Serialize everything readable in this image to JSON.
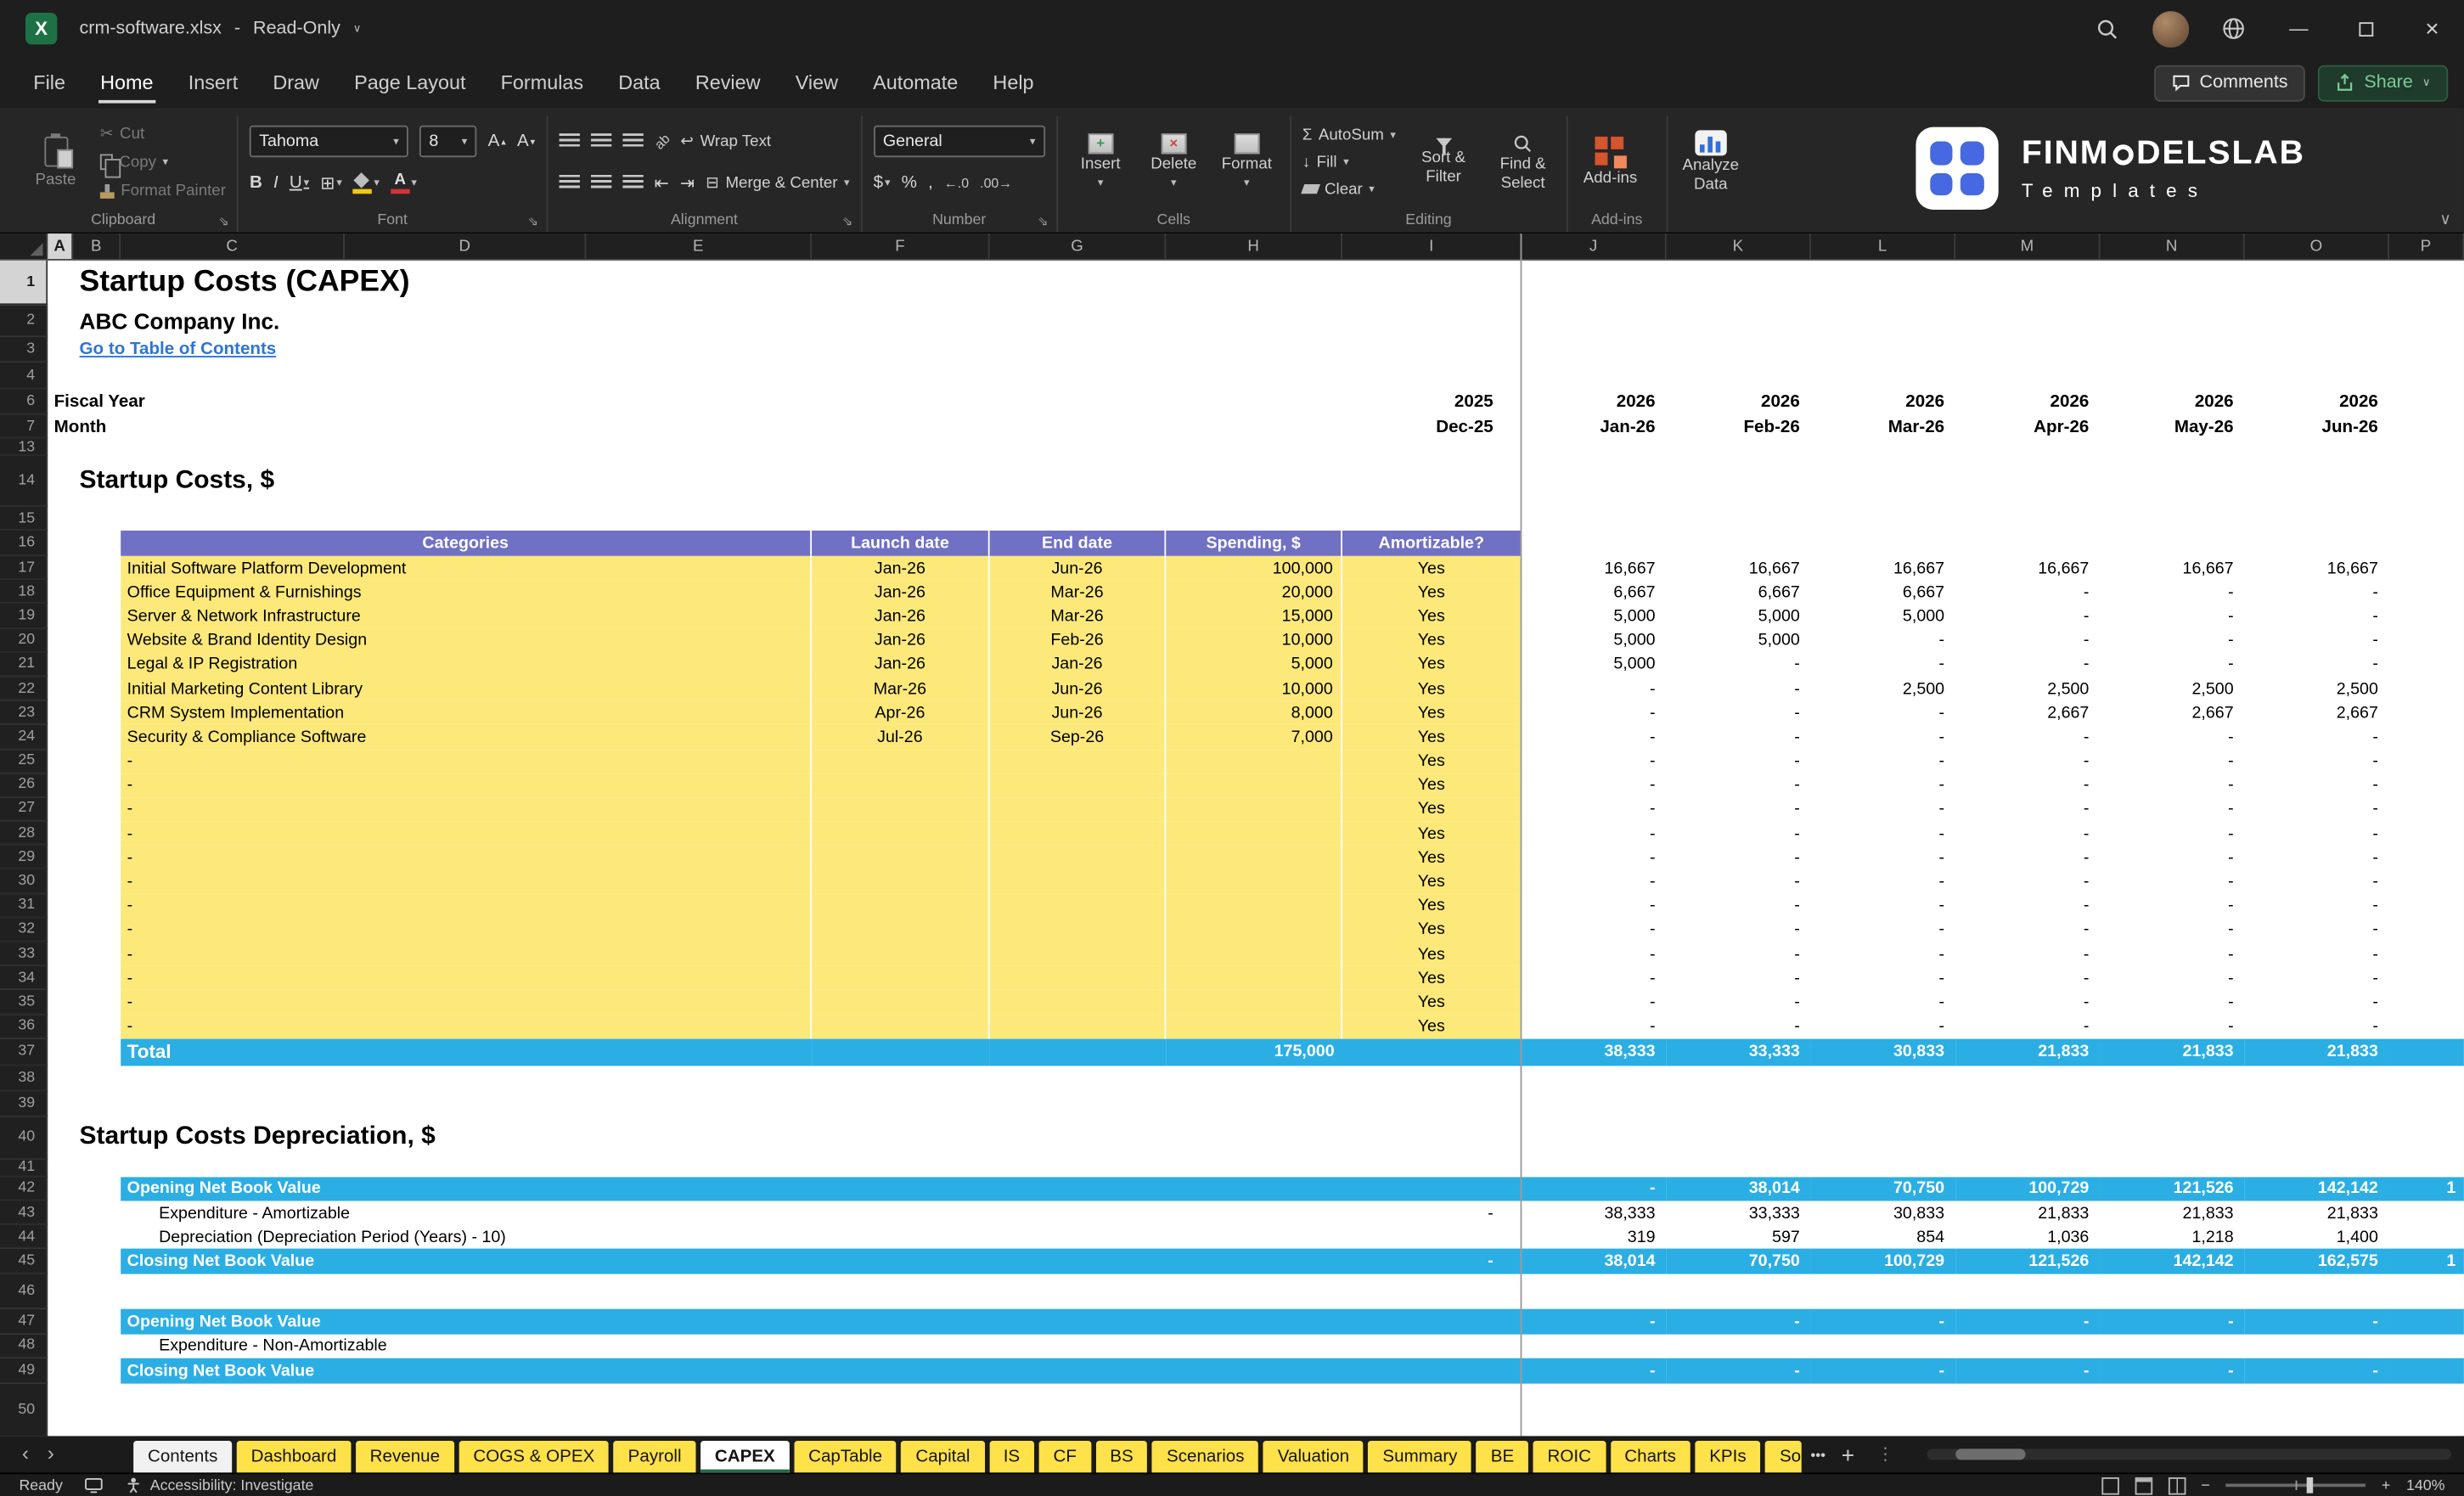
{
  "colors": {
    "band_blue": "#2BAEE4",
    "header_purple": "#7070C5",
    "cell_yellow": "#FDE97A",
    "tab_yellow": "#FFE14A",
    "link_blue": "#2E75D4",
    "excel_green": "#1E7145"
  },
  "icons": {
    "chevron_down": "▾",
    "chevron_small": "∨",
    "scissors": "✂",
    "sigma": "Σ",
    "borders": "⊞",
    "merge": "⊟",
    "wrap": "↩",
    "bold": "B",
    "italic": "I",
    "underline": "U",
    "dollar": "$",
    "percent": "%",
    "comma": ",",
    "increase_decimal": "←.0",
    "decrease_decimal": ".00→",
    "indent_left": "⇤",
    "indent_right": "⇥",
    "letter_a": "A",
    "up": "▴",
    "down": "▾",
    "minimize": "—",
    "close": "×",
    "nav_left": "‹",
    "nav_right": "›",
    "splitter": "⋮",
    "zoom_out": "−",
    "zoom_in": "+",
    "orientation": "ab",
    "excel_x": "X",
    "fill_arrow": "↓",
    "insert_plus": "+",
    "delete_x": "×"
  },
  "titlebar": {
    "filename": "crm-software.xlsx",
    "dash": "-",
    "mode": "Read-Only"
  },
  "menubar": {
    "items": [
      "File",
      "Home",
      "Insert",
      "Draw",
      "Page Layout",
      "Formulas",
      "Data",
      "Review",
      "View",
      "Automate",
      "Help"
    ],
    "active_item": "Home",
    "comments_label": "Comments",
    "share_label": "Share"
  },
  "ribbon": {
    "clipboard": {
      "label": "Clipboard",
      "paste": "Paste",
      "cut": "Cut",
      "copy": "Copy",
      "format_painter": "Format Painter"
    },
    "font": {
      "label": "Font",
      "font_name": "Tahoma",
      "font_size": "8"
    },
    "alignment": {
      "label": "Alignment",
      "wrap_text": "Wrap Text",
      "merge_center": "Merge & Center"
    },
    "number": {
      "label": "Number",
      "format": "General"
    },
    "cells": {
      "label": "Cells",
      "insert": "Insert",
      "delete": "Delete",
      "format": "Format"
    },
    "editing": {
      "label": "Editing",
      "autosum": "AutoSum",
      "fill": "Fill",
      "clear": "Clear",
      "sort_line1": "Sort &",
      "sort_line2": "Filter",
      "find_line1": "Find &",
      "find_line2": "Select"
    },
    "addins": {
      "label": "Add-ins",
      "addins_label": "Add-ins",
      "analyze_line1": "Analyze",
      "analyze_line2": "Data"
    },
    "logo": {
      "brand_pre": "FINM",
      "brand_post": "DELSLAB",
      "subtitle": "Templates"
    }
  },
  "sheet": {
    "columns": [
      "A",
      "B",
      "C",
      "D",
      "E",
      "F",
      "G",
      "H",
      "I",
      "J",
      "K",
      "L",
      "M",
      "N",
      "O",
      "P"
    ]
  },
  "grid_rows": [
    {
      "n": "1",
      "h": 28,
      "type": "title",
      "text": "Startup Costs (CAPEX)"
    },
    {
      "n": "2",
      "h": 20,
      "type": "subtitle",
      "text": "ABC Company Inc."
    },
    {
      "n": "3",
      "h": 16,
      "type": "link",
      "text": "Go to Table of Contents"
    },
    {
      "n": "4",
      "h": 17,
      "type": "blank"
    },
    {
      "n": "6",
      "h": 16,
      "type": "frozen",
      "label": "Fiscal Year",
      "dec": "2025",
      "vals": [
        "2026",
        "2026",
        "2026",
        "2026",
        "2026",
        "2026"
      ]
    },
    {
      "n": "7",
      "h": 15,
      "type": "frozen",
      "label": "Month",
      "dec": "Dec-25",
      "vals": [
        "Jan-26",
        "Feb-26",
        "Mar-26",
        "Apr-26",
        "May-26",
        "Jun-26"
      ]
    },
    {
      "n": "13",
      "h": 11,
      "type": "blank"
    },
    {
      "n": "14",
      "h": 32,
      "type": "section",
      "text": "Startup Costs, $"
    },
    {
      "n": "15",
      "h": 15,
      "type": "blank"
    },
    {
      "n": "16",
      "h": 16,
      "type": "thead",
      "cols": [
        "Categories",
        "Launch date",
        "End date",
        "Spending, $",
        "Amortizable?"
      ]
    },
    {
      "n": "17",
      "h": 15.2,
      "type": "item",
      "cat": "Initial Software Platform Development",
      "launch": "Jan-26",
      "end": "Jun-26",
      "spend": "100,000",
      "amort": "Yes",
      "vals": [
        "16,667",
        "16,667",
        "16,667",
        "16,667",
        "16,667",
        "16,667"
      ]
    },
    {
      "n": "18",
      "h": 15.2,
      "type": "item",
      "cat": "Office Equipment & Furnishings",
      "launch": "Jan-26",
      "end": "Mar-26",
      "spend": "20,000",
      "amort": "Yes",
      "vals": [
        "6,667",
        "6,667",
        "6,667",
        "-",
        "-",
        "-"
      ]
    },
    {
      "n": "19",
      "h": 15.2,
      "type": "item",
      "cat": "Server & Network Infrastructure",
      "launch": "Jan-26",
      "end": "Mar-26",
      "spend": "15,000",
      "amort": "Yes",
      "vals": [
        "5,000",
        "5,000",
        "5,000",
        "-",
        "-",
        "-"
      ]
    },
    {
      "n": "20",
      "h": 15.2,
      "type": "item",
      "cat": "Website & Brand Identity Design",
      "launch": "Jan-26",
      "end": "Feb-26",
      "spend": "10,000",
      "amort": "Yes",
      "vals": [
        "5,000",
        "5,000",
        "-",
        "-",
        "-",
        "-"
      ]
    },
    {
      "n": "21",
      "h": 15.2,
      "type": "item",
      "cat": "Legal & IP Registration",
      "launch": "Jan-26",
      "end": "Jan-26",
      "spend": "5,000",
      "amort": "Yes",
      "vals": [
        "5,000",
        "-",
        "-",
        "-",
        "-",
        "-"
      ]
    },
    {
      "n": "22",
      "h": 15.2,
      "type": "item",
      "cat": "Initial Marketing Content Library",
      "launch": "Mar-26",
      "end": "Jun-26",
      "spend": "10,000",
      "amort": "Yes",
      "vals": [
        "-",
        "-",
        "2,500",
        "2,500",
        "2,500",
        "2,500"
      ]
    },
    {
      "n": "23",
      "h": 15.2,
      "type": "item",
      "cat": "CRM System Implementation",
      "launch": "Apr-26",
      "end": "Jun-26",
      "spend": "8,000",
      "amort": "Yes",
      "vals": [
        "-",
        "-",
        "-",
        "2,667",
        "2,667",
        "2,667"
      ]
    },
    {
      "n": "24",
      "h": 15.2,
      "type": "item",
      "cat": "Security & Compliance Software",
      "launch": "Jul-26",
      "end": "Sep-26",
      "spend": "7,000",
      "amort": "Yes",
      "vals": [
        "-",
        "-",
        "-",
        "-",
        "-",
        "-"
      ]
    },
    {
      "n": "25",
      "h": 15.2,
      "type": "item",
      "cat": "-",
      "launch": "",
      "end": "",
      "spend": "",
      "amort": "Yes",
      "vals": [
        "-",
        "-",
        "-",
        "-",
        "-",
        "-"
      ]
    },
    {
      "n": "26",
      "h": 15.2,
      "type": "item",
      "cat": "-",
      "launch": "",
      "end": "",
      "spend": "",
      "amort": "Yes",
      "vals": [
        "-",
        "-",
        "-",
        "-",
        "-",
        "-"
      ]
    },
    {
      "n": "27",
      "h": 15.2,
      "type": "item",
      "cat": "-",
      "launch": "",
      "end": "",
      "spend": "",
      "amort": "Yes",
      "vals": [
        "-",
        "-",
        "-",
        "-",
        "-",
        "-"
      ]
    },
    {
      "n": "28",
      "h": 15.2,
      "type": "item",
      "cat": "-",
      "launch": "",
      "end": "",
      "spend": "",
      "amort": "Yes",
      "vals": [
        "-",
        "-",
        "-",
        "-",
        "-",
        "-"
      ]
    },
    {
      "n": "29",
      "h": 15.2,
      "type": "item",
      "cat": "-",
      "launch": "",
      "end": "",
      "spend": "",
      "amort": "Yes",
      "vals": [
        "-",
        "-",
        "-",
        "-",
        "-",
        "-"
      ]
    },
    {
      "n": "30",
      "h": 15.2,
      "type": "item",
      "cat": "-",
      "launch": "",
      "end": "",
      "spend": "",
      "amort": "Yes",
      "vals": [
        "-",
        "-",
        "-",
        "-",
        "-",
        "-"
      ]
    },
    {
      "n": "31",
      "h": 15.2,
      "type": "item",
      "cat": "-",
      "launch": "",
      "end": "",
      "spend": "",
      "amort": "Yes",
      "vals": [
        "-",
        "-",
        "-",
        "-",
        "-",
        "-"
      ]
    },
    {
      "n": "32",
      "h": 15.2,
      "type": "item",
      "cat": "-",
      "launch": "",
      "end": "",
      "spend": "",
      "amort": "Yes",
      "vals": [
        "-",
        "-",
        "-",
        "-",
        "-",
        "-"
      ]
    },
    {
      "n": "33",
      "h": 15.2,
      "type": "item",
      "cat": "-",
      "launch": "",
      "end": "",
      "spend": "",
      "amort": "Yes",
      "vals": [
        "-",
        "-",
        "-",
        "-",
        "-",
        "-"
      ]
    },
    {
      "n": "34",
      "h": 15.2,
      "type": "item",
      "cat": "-",
      "launch": "",
      "end": "",
      "spend": "",
      "amort": "Yes",
      "vals": [
        "-",
        "-",
        "-",
        "-",
        "-",
        "-"
      ]
    },
    {
      "n": "35",
      "h": 15.2,
      "type": "item",
      "cat": "-",
      "launch": "",
      "end": "",
      "spend": "",
      "amort": "Yes",
      "vals": [
        "-",
        "-",
        "-",
        "-",
        "-",
        "-"
      ]
    },
    {
      "n": "36",
      "h": 15.2,
      "type": "item",
      "cat": "-",
      "launch": "",
      "end": "",
      "spend": "",
      "amort": "Yes",
      "vals": [
        "-",
        "-",
        "-",
        "-",
        "-",
        "-"
      ]
    },
    {
      "n": "37",
      "h": 17,
      "type": "total",
      "label": "Total",
      "spend": "175,000",
      "vals": [
        "38,333",
        "33,333",
        "30,833",
        "21,833",
        "21,833",
        "21,833"
      ]
    },
    {
      "n": "38",
      "h": 16,
      "type": "blank"
    },
    {
      "n": "39",
      "h": 16,
      "type": "blank"
    },
    {
      "n": "40",
      "h": 27,
      "type": "section",
      "text": "Startup Costs Depreciation, $"
    },
    {
      "n": "41",
      "h": 11,
      "type": "blank"
    },
    {
      "n": "42",
      "h": 15.2,
      "type": "band",
      "label": "Opening Net Book Value",
      "dec": "",
      "vals": [
        "-",
        "38,014",
        "70,750",
        "100,729",
        "121,526",
        "142,142"
      ],
      "frag": "1"
    },
    {
      "n": "43",
      "h": 15.2,
      "type": "subitem",
      "label": "Expenditure - Amortizable",
      "dec": "-",
      "vals": [
        "38,333",
        "33,333",
        "30,833",
        "21,833",
        "21,833",
        "21,833"
      ]
    },
    {
      "n": "44",
      "h": 15.2,
      "type": "subitem",
      "label": "Depreciation (Depreciation Period (Years) - 10)",
      "dec": "",
      "vals": [
        "319",
        "597",
        "854",
        "1,036",
        "1,218",
        "1,400"
      ]
    },
    {
      "n": "45",
      "h": 16,
      "type": "band",
      "label": "Closing Net Book Value",
      "dec": "-",
      "vals": [
        "38,014",
        "70,750",
        "100,729",
        "121,526",
        "142,142",
        "162,575"
      ],
      "frag": "1"
    },
    {
      "n": "46",
      "h": 22,
      "type": "blank"
    },
    {
      "n": "47",
      "h": 15.2,
      "type": "band",
      "label": "Opening Net Book Value",
      "dec": "",
      "vals": [
        "-",
        "-",
        "-",
        "-",
        "-",
        "-"
      ]
    },
    {
      "n": "48",
      "h": 15.2,
      "type": "subitem",
      "label": "Expenditure - Non-Amortizable",
      "dec": "",
      "vals": [
        "",
        "",
        "",
        "",
        "",
        ""
      ]
    },
    {
      "n": "49",
      "h": 16,
      "type": "band",
      "label": "Closing Net Book Value",
      "dec": "",
      "vals": [
        "-",
        "-",
        "-",
        "-",
        "-",
        "-"
      ]
    },
    {
      "n": "50",
      "h": 34,
      "type": "blank"
    }
  ],
  "sheet_tabs": {
    "tabs": [
      {
        "label": "Contents",
        "style": "light"
      },
      {
        "label": "Dashboard",
        "style": "yellow"
      },
      {
        "label": "Revenue",
        "style": "yellow"
      },
      {
        "label": "COGS & OPEX",
        "style": "yellow"
      },
      {
        "label": "Payroll",
        "style": "yellow"
      },
      {
        "label": "CAPEX",
        "style": "active"
      },
      {
        "label": "CapTable",
        "style": "yellow"
      },
      {
        "label": "Capital",
        "style": "yellow"
      },
      {
        "label": "IS",
        "style": "yellow"
      },
      {
        "label": "CF",
        "style": "yellow"
      },
      {
        "label": "BS",
        "style": "yellow"
      },
      {
        "label": "Scenarios",
        "style": "yellow"
      },
      {
        "label": "Valuation",
        "style": "yellow"
      },
      {
        "label": "Summary",
        "style": "yellow"
      },
      {
        "label": "BE",
        "style": "yellow"
      },
      {
        "label": "ROIC",
        "style": "yellow"
      },
      {
        "label": "Charts",
        "style": "yellow"
      },
      {
        "label": "KPIs",
        "style": "yellow"
      },
      {
        "label": "So",
        "style": "yellow",
        "clipped": true
      }
    ],
    "overflow": "•••",
    "add": "+"
  },
  "statusbar": {
    "ready": "Ready",
    "accessibility": "Accessibility: Investigate",
    "zoom_level": "140%"
  }
}
